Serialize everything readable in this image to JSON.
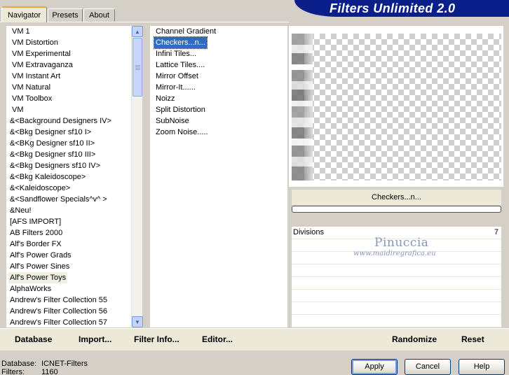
{
  "tabs": [
    {
      "label": "Navigator",
      "active": true
    },
    {
      "label": "Presets",
      "active": false
    },
    {
      "label": "About",
      "active": false
    }
  ],
  "window_title": "Filters Unlimited 2.0",
  "categories": [
    "VM 1",
    "VM Distortion",
    "VM Experimental",
    "VM Extravaganza",
    "VM Instant Art",
    "VM Natural",
    "VM Toolbox",
    "VM",
    "&<Background Designers IV>",
    "&<Bkg Designer sf10 I>",
    "&<BKg Designer sf10 II>",
    "&<Bkg Designer sf10 III>",
    "&<Bkg Designers sf10 IV>",
    "&<Bkg Kaleidoscope>",
    "&<Kaleidoscope>",
    "&<Sandflower Specials^v^ >",
    "&Neu!",
    "[AFS IMPORT]",
    "AB Filters 2000",
    "Alf's Border FX",
    "Alf's Power Grads",
    "Alf's Power Sines",
    "Alf's Power Toys",
    "AlphaWorks",
    "Andrew's Filter Collection 55",
    "Andrew's Filter Collection 56",
    "Andrew's Filter Collection 57"
  ],
  "categories_highlighted_index": 22,
  "filters": [
    "Channel Gradient",
    "Checkers...n...",
    "Infini Tiles...",
    "Lattice Tiles....",
    "Mirror Offset",
    "Mirror-It......",
    "Noizz",
    "Split Distortion",
    "SubNoise",
    "Zoom Noise....."
  ],
  "filters_selected_index": 1,
  "selected_filter_name": "Checkers...n...",
  "parameters": [
    {
      "label": "Divisions",
      "value": "7"
    }
  ],
  "watermark": {
    "line1": "Pinuccia",
    "line2": "www.maidiregrafica.eu"
  },
  "toolbar": {
    "database": "Database",
    "import": "Import...",
    "filter_info": "Filter Info...",
    "editor": "Editor...",
    "randomize": "Randomize",
    "reset": "Reset"
  },
  "footer": {
    "database_label": "Database:",
    "database_value": "ICNET-Filters",
    "filters_label": "Filters:",
    "filters_value": "1160"
  },
  "buttons": {
    "apply": "Apply",
    "cancel": "Cancel",
    "help": "Help"
  },
  "colors": {
    "banner": "#0a1f8a",
    "selection": "#316ac5",
    "accent_tab": "#f2a23a"
  }
}
